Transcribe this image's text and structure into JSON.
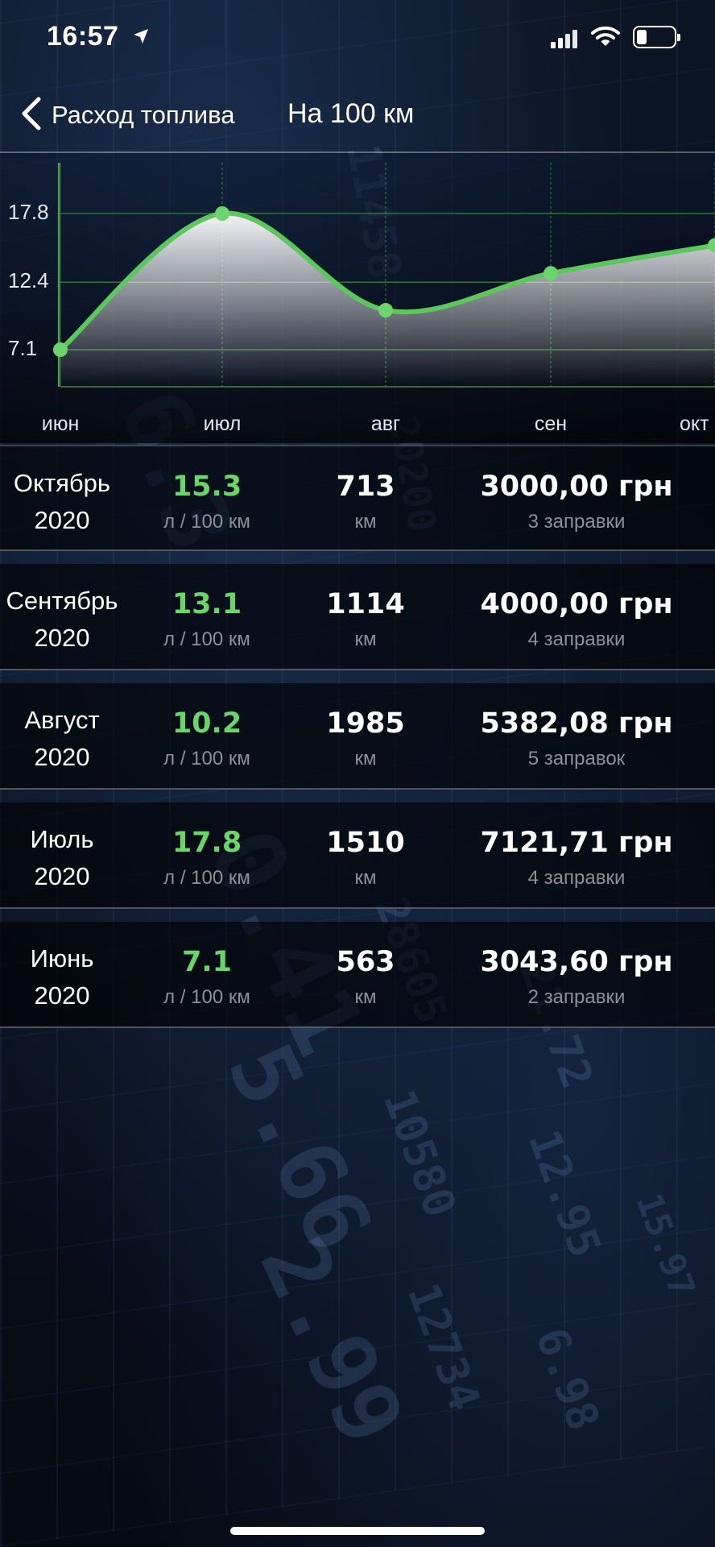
{
  "status_bar": {
    "time": "16:57",
    "icons": [
      "location-arrow-icon",
      "signal-icon",
      "wifi-icon",
      "battery-icon"
    ]
  },
  "nav": {
    "back_label": "Расход топлива",
    "title": "На 100 км"
  },
  "chart_data": {
    "type": "line",
    "categories": [
      "июн",
      "июл",
      "авг",
      "сен",
      "окт"
    ],
    "values": [
      7.1,
      17.8,
      10.2,
      13.1,
      15.3
    ],
    "y_ticks": [
      "17.8",
      "12.4",
      "7.1"
    ],
    "ylim": [
      5.0,
      20.0
    ],
    "line_color": "#5cc75c",
    "smooth": true,
    "area_fill": true,
    "grid": true
  },
  "rows": [
    {
      "month": "Октябрь",
      "year": "2020",
      "consumption": "15.3",
      "consumption_unit": "л / 100 км",
      "distance": "713",
      "distance_unit": "км",
      "cost": "3000,00 грн",
      "refuels": "3 заправки"
    },
    {
      "month": "Сентябрь",
      "year": "2020",
      "consumption": "13.1",
      "consumption_unit": "л / 100 км",
      "distance": "1114",
      "distance_unit": "км",
      "cost": "4000,00 грн",
      "refuels": "4 заправки"
    },
    {
      "month": "Август",
      "year": "2020",
      "consumption": "10.2",
      "consumption_unit": "л / 100 км",
      "distance": "1985",
      "distance_unit": "км",
      "cost": "5382,08 грн",
      "refuels": "5 заправок"
    },
    {
      "month": "Июль",
      "year": "2020",
      "consumption": "17.8",
      "consumption_unit": "л / 100 км",
      "distance": "1510",
      "distance_unit": "км",
      "cost": "7121,71 грн",
      "refuels": "4 заправки"
    },
    {
      "month": "Июнь",
      "year": "2020",
      "consumption": "7.1",
      "consumption_unit": "л / 100 км",
      "distance": "563",
      "distance_unit": "км",
      "cost": "3043,60 грн",
      "refuels": "2 заправки"
    }
  ],
  "colors": {
    "accent_green": "#6bd46b",
    "background": "#070b12",
    "muted_text": "#8c9097"
  }
}
